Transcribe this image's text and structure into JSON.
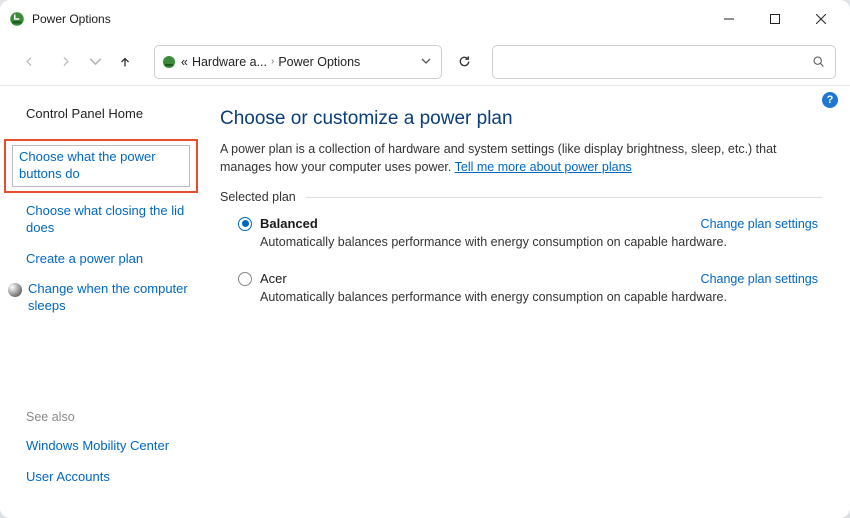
{
  "window": {
    "title": "Power Options"
  },
  "breadcrumb": {
    "pre": "«",
    "part1": "Hardware a...",
    "part2": "Power Options"
  },
  "sidebar": {
    "home": "Control Panel Home",
    "links": {
      "choose_buttons": "Choose what the power buttons do",
      "choose_lid": "Choose what closing the lid does",
      "create_plan": "Create a power plan",
      "change_sleep": "Change when the computer sleeps"
    },
    "see_also_label": "See also",
    "see_also": {
      "mobility": "Windows Mobility Center",
      "accounts": "User Accounts"
    }
  },
  "main": {
    "heading": "Choose or customize a power plan",
    "desc_part1": "A power plan is a collection of hardware and system settings (like display brightness, sleep, etc.) that manages how your computer uses power. ",
    "desc_link": "Tell me more about power plans",
    "section_label": "Selected plan",
    "change_settings_label": "Change plan settings",
    "plans": [
      {
        "name": "Balanced",
        "selected": true,
        "desc": "Automatically balances performance with energy consumption on capable hardware."
      },
      {
        "name": "Acer",
        "selected": false,
        "desc": "Automatically balances performance with energy consumption on capable hardware."
      }
    ]
  },
  "help_badge": "?"
}
